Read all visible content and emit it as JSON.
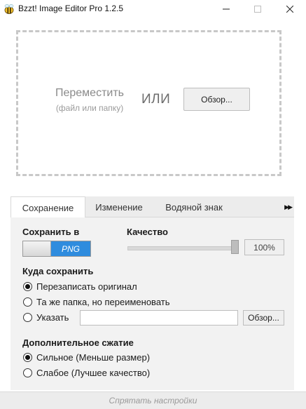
{
  "window": {
    "title": "Bzzt! Image Editor Pro 1.2.5",
    "icon": "bee-icon",
    "controls": {
      "minimize": "—",
      "maximize": "☐",
      "close": "✕"
    }
  },
  "drop_zone": {
    "move_label": "Переместить",
    "move_sub": "(файл или папку)",
    "or_label": "ИЛИ",
    "browse_label": "Обзор..."
  },
  "tabs": [
    {
      "label": "Сохранение",
      "active": true
    },
    {
      "label": "Изменение",
      "active": false
    },
    {
      "label": "Водяной знак",
      "active": false
    }
  ],
  "tab_scroll": "▶▶",
  "save_panel": {
    "save_as_label": "Сохранить в",
    "format_value": "PNG",
    "quality_label": "Качество",
    "quality_value": "100%",
    "quality_level": 1.0,
    "destination_label": "Куда сохранить",
    "destination_options": [
      {
        "label": "Перезаписать оригинал",
        "selected": true
      },
      {
        "label": "Та же папка, но переименовать",
        "selected": false
      },
      {
        "label": "Указать",
        "selected": false
      }
    ],
    "path_value": "",
    "path_browse_label": "Обзор...",
    "compression_label": "Дополнительное сжатие",
    "compression_options": [
      {
        "label": "Сильное (Меньше размер)",
        "selected": true
      },
      {
        "label": "Слабое (Лучшее качество)",
        "selected": false
      }
    ]
  },
  "footer": {
    "hide_settings": "Спрятать настройки"
  },
  "colors": {
    "accent": "#2f8cde",
    "panel": "#f2f2f2",
    "tabbar": "#ececec"
  }
}
